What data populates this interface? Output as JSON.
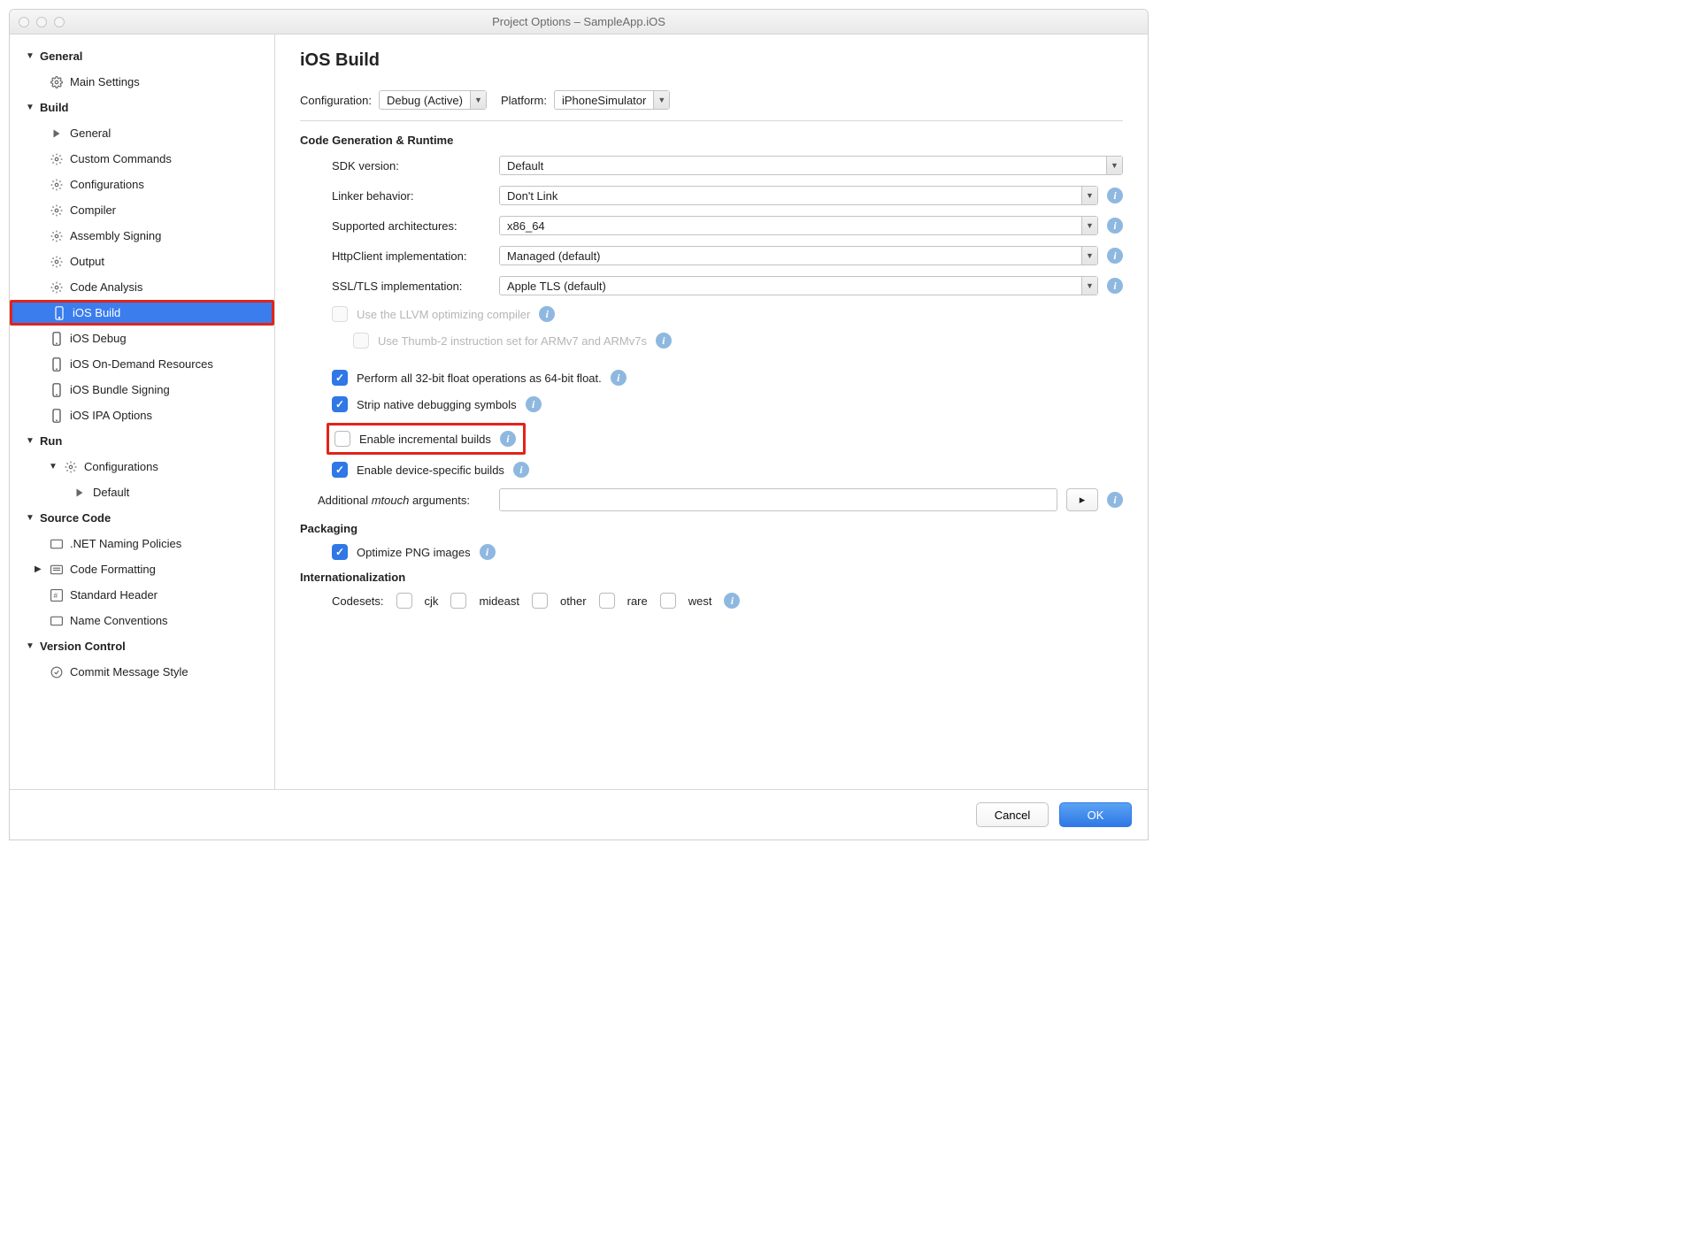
{
  "window_title": "Project Options – SampleApp.iOS",
  "sidebar": {
    "general": {
      "label": "General",
      "items": [
        "Main Settings"
      ]
    },
    "build": {
      "label": "Build",
      "items": [
        "General",
        "Custom Commands",
        "Configurations",
        "Compiler",
        "Assembly Signing",
        "Output",
        "Code Analysis",
        "iOS Build",
        "iOS Debug",
        "iOS On-Demand Resources",
        "iOS Bundle Signing",
        "iOS IPA Options"
      ],
      "selected": "iOS Build"
    },
    "run": {
      "label": "Run",
      "configurations_label": "Configurations",
      "items": [
        "Default"
      ]
    },
    "source_code": {
      "label": "Source Code",
      "items": [
        ".NET Naming Policies",
        "Code Formatting",
        "Standard Header",
        "Name Conventions"
      ]
    },
    "version_control": {
      "label": "Version Control",
      "items": [
        "Commit Message Style"
      ]
    }
  },
  "page": {
    "title": "iOS Build",
    "config_label": "Configuration:",
    "config_value": "Debug (Active)",
    "platform_label": "Platform:",
    "platform_value": "iPhoneSimulator"
  },
  "codegen": {
    "title": "Code Generation & Runtime",
    "rows": {
      "sdk": {
        "label": "SDK version:",
        "value": "Default"
      },
      "linker": {
        "label": "Linker behavior:",
        "value": "Don't Link"
      },
      "arch": {
        "label": "Supported architectures:",
        "value": "x86_64"
      },
      "http": {
        "label": "HttpClient implementation:",
        "value": "Managed (default)"
      },
      "ssl": {
        "label": "SSL/TLS implementation:",
        "value": "Apple TLS (default)"
      }
    },
    "checks": {
      "llvm": {
        "label": "Use the LLVM optimizing compiler",
        "checked": false,
        "disabled": true
      },
      "thumb": {
        "label": "Use Thumb-2 instruction set for ARMv7 and ARMv7s",
        "checked": false,
        "disabled": true
      },
      "float32": {
        "label": "Perform all 32-bit float operations as 64-bit float.",
        "checked": true
      },
      "strip": {
        "label": "Strip native debugging symbols",
        "checked": true
      },
      "incremental": {
        "label": "Enable incremental builds",
        "checked": false
      },
      "devicespec": {
        "label": "Enable device-specific builds",
        "checked": true
      }
    },
    "mtouch_label_pre": "Additional ",
    "mtouch_label_em": "mtouch",
    "mtouch_label_post": " arguments:",
    "mtouch_value": ""
  },
  "packaging": {
    "title": "Packaging",
    "optimize_png": {
      "label": "Optimize PNG images",
      "checked": true
    }
  },
  "i18n": {
    "title": "Internationalization",
    "codesets_label": "Codesets:",
    "sets": [
      "cjk",
      "mideast",
      "other",
      "rare",
      "west"
    ]
  },
  "footer": {
    "cancel": "Cancel",
    "ok": "OK"
  }
}
